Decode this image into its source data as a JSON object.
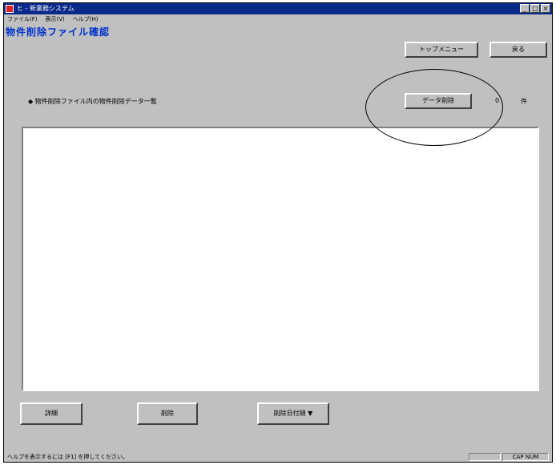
{
  "titlebar": {
    "title": "ヒ - 新業務システム",
    "icon": "app-icon",
    "min_label": "_",
    "max_label": "□",
    "close_label": "×"
  },
  "menubar": {
    "items": [
      "ファイル(F)",
      "表示(V)",
      "ヘルプ(H)"
    ]
  },
  "page": {
    "title": "物件削除ファイル確認"
  },
  "toolbar": {
    "top_button_label": "トップメニュー",
    "back_button_label": "戻る",
    "data_button_label": "データ削除"
  },
  "list": {
    "label": "◆ 物件削除ファイル内の物件削除データ一覧",
    "count": "0",
    "unit": "件",
    "items": []
  },
  "bottom_buttons": {
    "detail_label": "詳細",
    "delete_label": "削除",
    "date_label": "削除日付順 ▼"
  },
  "statusbar": {
    "message": "ヘルプを表示するには [F1] を押してください。",
    "panel1": "",
    "panel2": "CAP NUM"
  },
  "colors": {
    "titlebar": "#0a2a8a",
    "window_bg": "#c0c0c0",
    "title_text": "#0033cc"
  }
}
